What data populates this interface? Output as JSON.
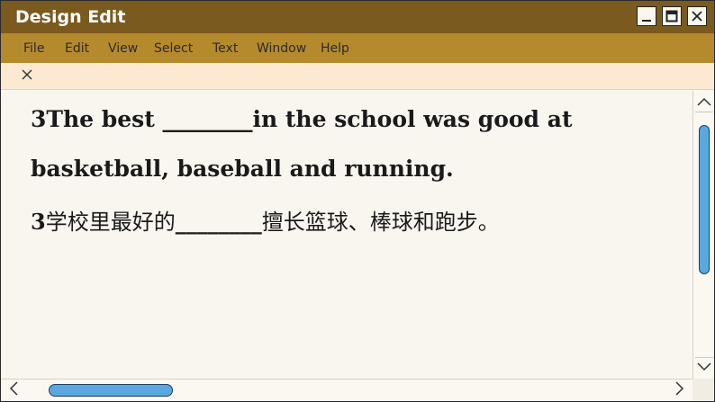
{
  "window": {
    "title": "Design Edit"
  },
  "menubar": {
    "items": [
      "File",
      "Edit",
      "View",
      "Select",
      "Text",
      "Window",
      "Help"
    ]
  },
  "document": {
    "line1": "3The best ________in the school was good at",
    "line2": "basketball, baseball and running.",
    "line3_num": "3",
    "line3_before": "学校里最好的",
    "line3_blank": "________",
    "line3_after": "擅长篮球、棒球和跑步。"
  },
  "colors": {
    "titlebar": "#7a5a1e",
    "menubar": "#b58a2c",
    "tabbar": "#fde9d2",
    "scroll_thumb": "#5aa8e0"
  },
  "icons": {
    "minimize": "minimize-icon",
    "maximize": "maximize-icon",
    "close": "close-icon",
    "tab_close": "close-icon",
    "scroll_up": "chevron-up-icon",
    "scroll_down": "chevron-down-icon",
    "scroll_left": "chevron-left-icon",
    "scroll_right": "chevron-right-icon"
  }
}
